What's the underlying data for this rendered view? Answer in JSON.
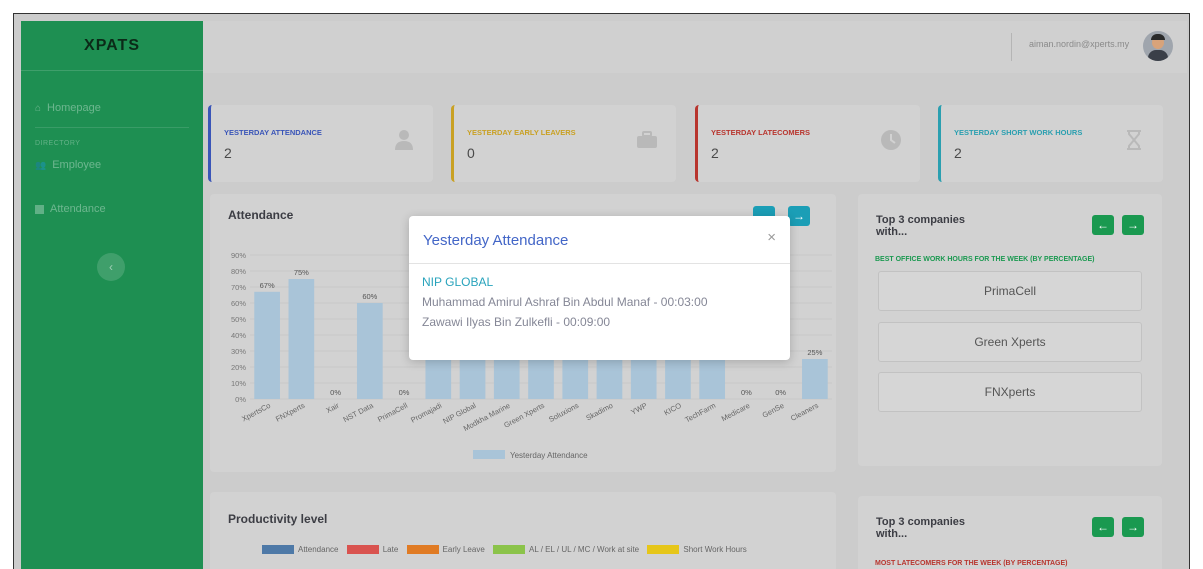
{
  "brand": "XPATS",
  "sidebar": {
    "homepage": "Homepage",
    "directory_heading": "DIRECTORY",
    "employee": "Employee",
    "attendance": "Attendance"
  },
  "topbar": {
    "user_email": "aiman.nordin@xperts.my"
  },
  "stats": [
    {
      "label": "YESTERDAY ATTENDANCE",
      "value": "2",
      "color": "#3a55b8",
      "icon": "user-icon"
    },
    {
      "label": "YESTERDAY EARLY LEAVERS",
      "value": "0",
      "color": "#c9a124",
      "icon": "briefcase-icon"
    },
    {
      "label": "YESTERDAY LATECOMERS",
      "value": "2",
      "color": "#b8352e",
      "icon": "clock-icon"
    },
    {
      "label": "YESTERDAY SHORT WORK HOURS",
      "value": "2",
      "color": "#2a9fb0",
      "icon": "hourglass-icon"
    }
  ],
  "attendance_panel": {
    "title": "Attendance",
    "legend": "Yesterday Attendance"
  },
  "chart_data": {
    "type": "bar",
    "categories": [
      "XpertsCo",
      "FNXperts",
      "Xair",
      "NST Data",
      "PrimaCell",
      "Promajadi",
      "NIP Global",
      "Modkha Marine",
      "Green Xperts",
      "Soluxions",
      "Skadimo",
      "YWP",
      "KICO",
      "TechFarm",
      "Medicare",
      "GenSe",
      "Cleaners"
    ],
    "series": [
      {
        "name": "Yesterday Attendance",
        "values": [
          67,
          75,
          0,
          60,
          0,
          40,
          40,
          40,
          40,
          40,
          40,
          40,
          40,
          40,
          0,
          0,
          25
        ]
      }
    ],
    "data_labels": [
      "67%",
      "75%",
      "0%",
      "60%",
      "0%",
      "",
      "",
      "",
      "",
      "",
      "",
      "",
      "",
      "",
      "0%",
      "0%",
      "25%"
    ],
    "y_ticks": [
      "0%",
      "10%",
      "20%",
      "30%",
      "40%",
      "50%",
      "60%",
      "70%",
      "80%",
      "90%"
    ],
    "ylim": [
      0,
      90
    ],
    "grid": true,
    "legend_position": "bottom",
    "bar_color": "#a9c4d8"
  },
  "top_companies_1": {
    "title": "Top 3 companies with...",
    "subtitle": "BEST OFFICE WORK HOURS FOR THE WEEK (BY PERCENTAGE)",
    "items": [
      "PrimaCell",
      "Green Xperts",
      "FNXperts"
    ]
  },
  "productivity_panel": {
    "title": "Productivity level",
    "legend": [
      {
        "label": "Attendance",
        "color": "#4e79a7"
      },
      {
        "label": "Late",
        "color": "#d9534f"
      },
      {
        "label": "Early Leave",
        "color": "#e07b24"
      },
      {
        "label": "AL / EL / UL / MC / Work at site",
        "color": "#8bc34a"
      },
      {
        "label": "Short Work Hours",
        "color": "#e6c619"
      }
    ]
  },
  "top_companies_2": {
    "title": "Top 3 companies with...",
    "subtitle": "MOST LATECOMERS FOR THE WEEK (BY PERCENTAGE)"
  },
  "modal": {
    "title": "Yesterday Attendance",
    "close": "×",
    "company": "NIP GLOBAL",
    "entries": [
      "Muhammad Amirul Ashraf Bin Abdul Manaf - 00:03:00",
      "Zawawi Ilyas Bin Zulkefli - 00:09:00"
    ]
  }
}
